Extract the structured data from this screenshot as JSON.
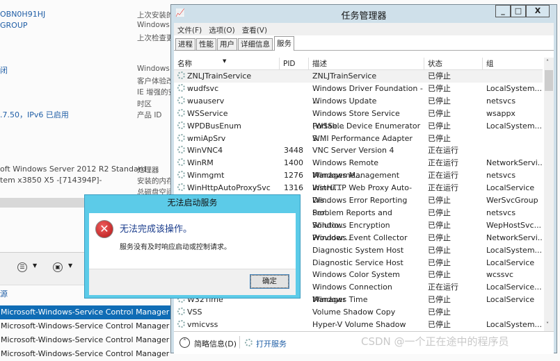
{
  "background": {
    "left_values": [
      "OBN0H91HJ",
      "GROUP",
      "闭",
      ".7.50，IPv6 已启用",
      "oft Windows Server 2012 R2 Standard",
      "tem x3850 X5 -[714394P]-"
    ],
    "right_labels": [
      "上次安装的",
      "Windows",
      "上次检查更",
      "Windows",
      "客户体验改",
      "IE 增强的安",
      "时区",
      "产品 ID",
      "处理器",
      "安装的内存",
      "总磁盘空间"
    ],
    "source_label": "源",
    "events": [
      "Microsoft-Windows-Service Control Manager",
      "Microsoft-Windows-Service Control Manager",
      "Microsoft-Windows-Service Control Manager",
      "Microsoft-Windows-Service Control Manager"
    ]
  },
  "task_manager": {
    "title": "任务管理器",
    "window_buttons": {
      "minimize": "_",
      "maximize": "□",
      "close": "X"
    },
    "menu": [
      "文件(F)",
      "选项(O)",
      "查看(V)"
    ],
    "tabs": [
      "进程",
      "性能",
      "用户",
      "详细信息",
      "服务"
    ],
    "active_tab": "服务",
    "columns": [
      "名称",
      "PID",
      "描述",
      "状态",
      "组"
    ],
    "rows": [
      {
        "name": "ZNLJTrainService",
        "pid": "",
        "desc": "ZNLJTrainService",
        "status": "已停止",
        "group": ""
      },
      {
        "name": "wudfsvc",
        "pid": "",
        "desc": "Windows Driver Foundation - ...",
        "status": "已停止",
        "group": "LocalSystem..."
      },
      {
        "name": "wuauserv",
        "pid": "",
        "desc": "Windows Update",
        "status": "已停止",
        "group": "netsvcs"
      },
      {
        "name": "WSService",
        "pid": "",
        "desc": "Windows Store Service (WSSe...",
        "status": "已停止",
        "group": "wsappx"
      },
      {
        "name": "WPDBusEnum",
        "pid": "",
        "desc": "Portable Device Enumerator S...",
        "status": "已停止",
        "group": "LocalSystem..."
      },
      {
        "name": "wmiApSrv",
        "pid": "",
        "desc": "WMI Performance Adapter",
        "status": "已停止",
        "group": ""
      },
      {
        "name": "WinVNC4",
        "pid": "3448",
        "desc": "VNC Server Version 4",
        "status": "正在运行",
        "group": ""
      },
      {
        "name": "WinRM",
        "pid": "1400",
        "desc": "Windows Remote Manageme...",
        "status": "正在运行",
        "group": "NetworkServi..."
      },
      {
        "name": "Winmgmt",
        "pid": "1276",
        "desc": "Windows Management Instru...",
        "status": "正在运行",
        "group": "netsvcs"
      },
      {
        "name": "WinHttpAutoProxySvc",
        "pid": "1316",
        "desc": "WinHTTP Web Proxy Auto-Dis...",
        "status": "正在运行",
        "group": "LocalService"
      },
      {
        "name": "",
        "pid": "",
        "desc": "Windows Error Reporting Ser...",
        "status": "已停止",
        "group": "WerSvcGroup"
      },
      {
        "name": "",
        "pid": "",
        "desc": "Problem Reports and Solutio...",
        "status": "已停止",
        "group": "netsvcs"
      },
      {
        "name": "",
        "pid": "",
        "desc": "Windows Encryption Provider...",
        "status": "已停止",
        "group": "WepHostSvc..."
      },
      {
        "name": "",
        "pid": "",
        "desc": "Windows Event Collector",
        "status": "已停止",
        "group": "NetworkServi..."
      },
      {
        "name": "",
        "pid": "",
        "desc": "Diagnostic System Host",
        "status": "已停止",
        "group": "LocalSystem..."
      },
      {
        "name": "",
        "pid": "",
        "desc": "Diagnostic Service Host",
        "status": "已停止",
        "group": "LocalService"
      },
      {
        "name": "",
        "pid": "",
        "desc": "Windows Color System",
        "status": "已停止",
        "group": "wcssvc"
      },
      {
        "name": "",
        "pid": "",
        "desc": "Windows Connection Manager",
        "status": "正在运行",
        "group": "LocalService..."
      },
      {
        "name": "W32Time",
        "pid": "",
        "desc": "Windows Time",
        "status": "已停止",
        "group": "LocalService"
      },
      {
        "name": "VSS",
        "pid": "",
        "desc": "Volume Shadow Copy",
        "status": "已停止",
        "group": ""
      },
      {
        "name": "vmicvss",
        "pid": "",
        "desc": "Hyper-V Volume Shadow Cop...",
        "status": "已停止",
        "group": "LocalSystem..."
      }
    ],
    "footer": {
      "less_details": "简略信息(D)",
      "open_services": "打开服务"
    }
  },
  "dialog": {
    "title": "无法启动服务",
    "heading": "无法完成该操作。",
    "message": "服务没有及时响应启动或控制请求。",
    "ok": "确定"
  },
  "watermark": "CSDN @一个正在途中的程序员"
}
